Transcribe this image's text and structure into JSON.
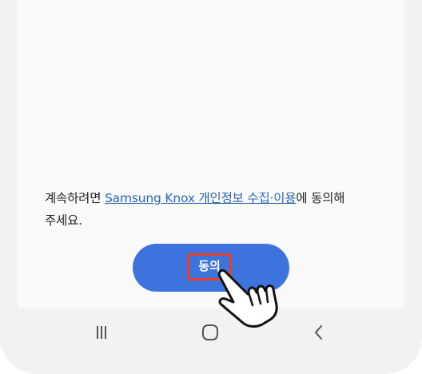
{
  "consent": {
    "prefix": "계속하려면 ",
    "link_text": "Samsung Knox 개인정보 수집·이용",
    "suffix_line1": "에 동의해",
    "line2": "주세요."
  },
  "agree_button": {
    "label": "동의"
  },
  "navbar": {
    "recent_icon": "recent-apps-icon",
    "home_icon": "home-icon",
    "back_icon": "back-icon"
  },
  "overlay": {
    "pointer_icon": "hand-pointer-icon",
    "highlight_color": "#e8412a"
  },
  "colors": {
    "accent": "#3d73dc",
    "link": "#2b64b8"
  }
}
